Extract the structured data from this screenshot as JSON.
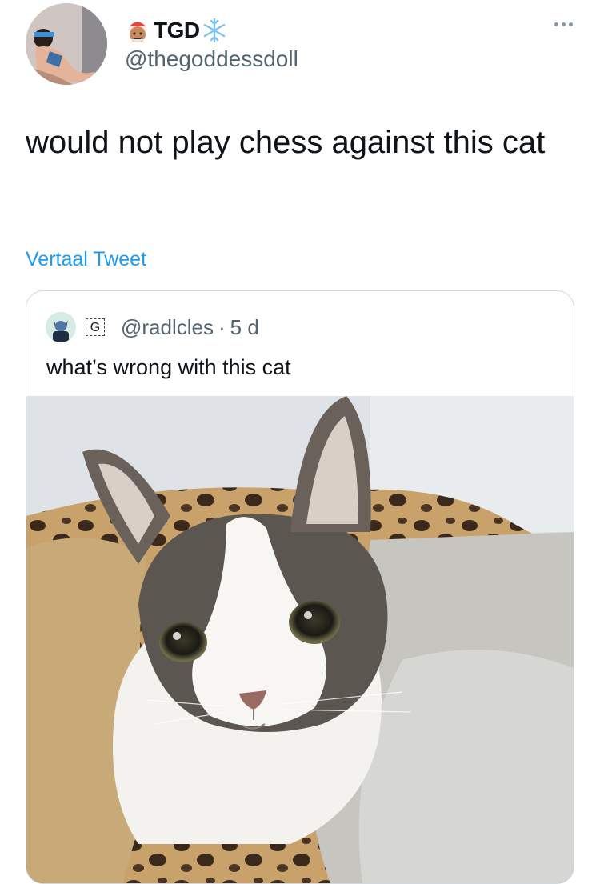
{
  "author": {
    "display_name": "TGD",
    "handle": "@thegoddessdoll",
    "avatar_icon": "profile-photo"
  },
  "tweet": {
    "text": "would not play chess against this cat",
    "translate_label": "Vertaal Tweet"
  },
  "quote": {
    "badge": "G",
    "handle": "@radlcles",
    "separator": "·",
    "time": "5 d",
    "text": "what’s wrong with this cat",
    "image_icon": "cat-photo"
  },
  "colors": {
    "link": "#1d9bf0",
    "muted": "#536471",
    "border": "#cfd9de"
  }
}
